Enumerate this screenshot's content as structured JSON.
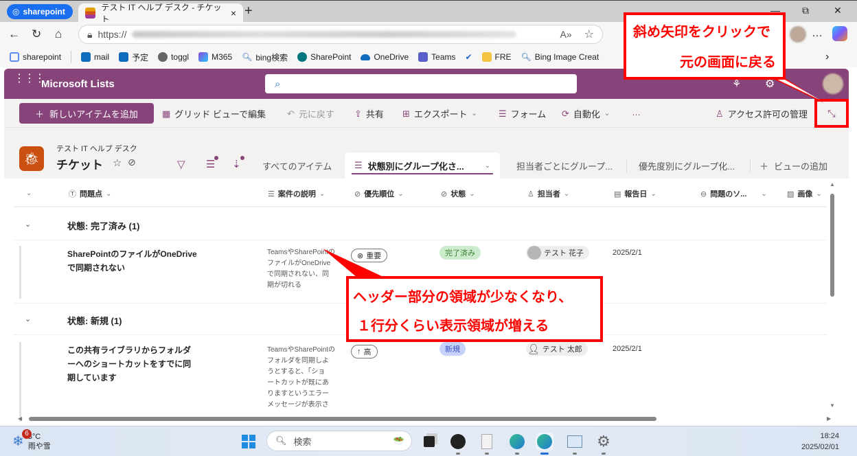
{
  "browser": {
    "profile_label": "sharepoint",
    "tab_title": "テスト IT ヘルプ デスク - チケット",
    "tab_close": "×",
    "new_tab": "+",
    "window_controls": {
      "minimize": "—",
      "restore": "⧉",
      "close": "✕"
    },
    "url_prefix": "https://",
    "nav": {
      "back": "←",
      "refresh": "↻",
      "home": "⌂"
    },
    "more_label": "…",
    "bookmarks": [
      {
        "label": "sharepoint",
        "icon": "sharepoint-icon",
        "color": "#5b8def"
      },
      {
        "label": "mail",
        "icon": "outlook-icon",
        "color": "#0f6cbd"
      },
      {
        "label": "予定",
        "icon": "outlook-icon",
        "color": "#0f6cbd"
      },
      {
        "label": "toggl",
        "icon": "toggl-icon",
        "color": "#666666"
      },
      {
        "label": "M365",
        "icon": "m365-icon",
        "color": "#8a4ad6"
      },
      {
        "label": "bing検索",
        "icon": "search-icon",
        "color": "#1a5fb4"
      },
      {
        "label": "SharePoint",
        "icon": "sharepoint-icon",
        "color": "#03787c"
      },
      {
        "label": "OneDrive",
        "icon": "onedrive-icon",
        "color": "#0f6cbd"
      },
      {
        "label": "Teams",
        "icon": "teams-icon",
        "color": "#5b5fc7"
      },
      {
        "label": "",
        "icon": "todo-check-icon",
        "color": "#2564cf"
      },
      {
        "label": "FRE",
        "icon": "fre-icon",
        "color": "#f5c342"
      },
      {
        "label": "Bing Image Creat",
        "icon": "search-icon",
        "color": "#1a5fb4"
      }
    ],
    "bookmarks_overflow": "›"
  },
  "app": {
    "title": "Microsoft Lists",
    "brand_color": "#87447a"
  },
  "commands": {
    "new_item": "新しいアイテムを追加",
    "grid_edit": "グリッド ビューで編集",
    "undo": "元に戻す",
    "share": "共有",
    "export": "エクスポート",
    "forms": "フォーム",
    "automate": "自動化",
    "more": "…",
    "access": "アクセス許可の管理"
  },
  "list": {
    "site_name": "テスト IT ヘルプ デスク",
    "name": "チケット",
    "views": [
      {
        "label": "すべてのアイテム",
        "active": false
      },
      {
        "label": "状態別にグループ化さ...",
        "active": true
      },
      {
        "label": "担当者ごとにグループ...",
        "active": false
      },
      {
        "label": "優先度別にグループ化...",
        "active": false
      }
    ],
    "add_view": "ビューの追加"
  },
  "columns": [
    {
      "label": "問題点",
      "icon": "text-icon"
    },
    {
      "label": "案件の説明",
      "icon": "multiline-icon"
    },
    {
      "label": "優先順位",
      "icon": "choice-icon"
    },
    {
      "label": "状態",
      "icon": "choice-icon"
    },
    {
      "label": "担当者",
      "icon": "person-icon"
    },
    {
      "label": "報告日",
      "icon": "calendar-icon"
    },
    {
      "label": "問題のソ...",
      "icon": "link-icon"
    },
    {
      "label": "画像",
      "icon": "image-icon"
    }
  ],
  "groups": [
    {
      "title": "状態: 完了済み (1)",
      "rows": [
        {
          "title_lines": [
            "SharePointのファイルがOneDrive",
            "で同期されない"
          ],
          "desc_lines": [
            "TeamsやSharePointの",
            "ファイルがOneDrive",
            "で同期されない、同",
            "期が切れる"
          ],
          "priority": "重要",
          "priority_icon": "⊗",
          "status": "完了済み",
          "assignee": "テスト 花子",
          "date": "2025/2/1"
        }
      ]
    },
    {
      "title": "状態: 新規 (1)",
      "rows": [
        {
          "title_lines": [
            "この共有ライブラリからフォルダ",
            "ーへのショートカットをすでに同",
            "期しています"
          ],
          "desc_lines": [
            "TeamsやSharePointの",
            "フォルダを同期しよ",
            "うとすると、「ショ",
            "ートカットが既にあ",
            "りますというエラー",
            "メッセージが表示さ"
          ],
          "priority": "高",
          "priority_icon": "↑",
          "status": "新規",
          "assignee": "テスト 太郎",
          "date": "2025/2/1"
        }
      ]
    }
  ],
  "annotations": {
    "top_line1": "斜め矢印をクリックで",
    "top_line2": "元の画面に戻る",
    "mid_line1": "ヘッダー部分の領域が少なくなり、",
    "mid_line2": "１行分くらい表示領域が増える",
    "color": "#ff0000"
  },
  "taskbar": {
    "weather_badge": "6",
    "temperature": "3°C",
    "weather": "雨や雪",
    "search_placeholder": "検索",
    "time": "18:24",
    "date": "2025/02/01"
  }
}
